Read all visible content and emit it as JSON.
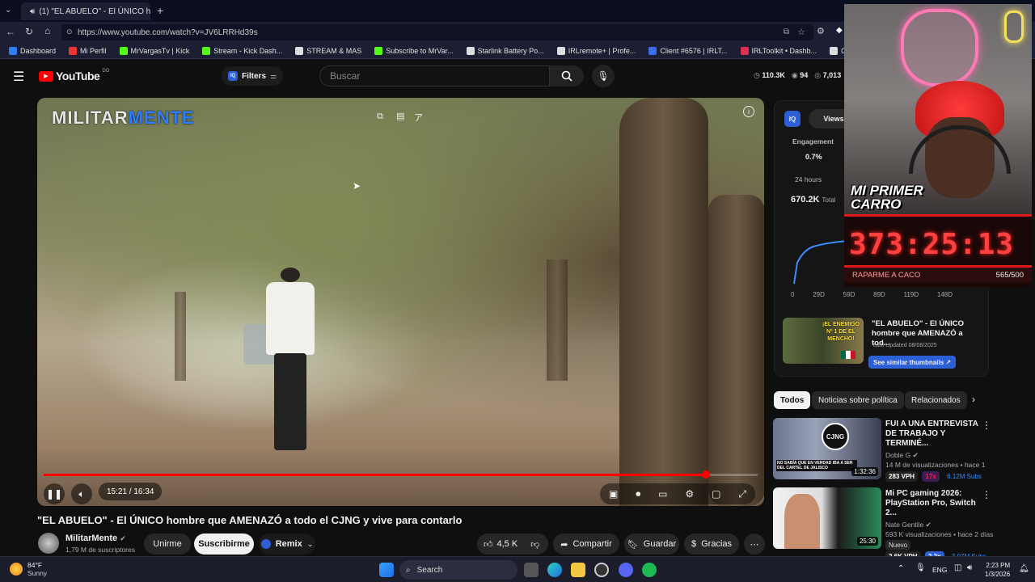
{
  "browser": {
    "tab_title": "(1) \"EL ABUELO\" - El ÚNICO h",
    "url": "https://www.youtube.com/watch?v=JV6LRRHd39s",
    "bookmarks": [
      {
        "label": "Dashboard",
        "color": "#2e7df6"
      },
      {
        "label": "Mi Perfil",
        "color": "#e33"
      },
      {
        "label": "MrVargasTv | Kick",
        "color": "#53fc18"
      },
      {
        "label": "Stream - Kick Dash...",
        "color": "#53fc18"
      },
      {
        "label": "STREAM & MAS",
        "color": "#ddd"
      },
      {
        "label": "Subscribe to MrVar...",
        "color": "#53fc18"
      },
      {
        "label": "Starlink Battery Po...",
        "color": "#ddd"
      },
      {
        "label": "IRLremote+ | Profe...",
        "color": "#ddd"
      },
      {
        "label": "Client #6576 | IRLT...",
        "color": "#3a6ee8"
      },
      {
        "label": "IRLToolkit • Dashb...",
        "color": "#e03050"
      },
      {
        "label": "CONTADOR",
        "color": "#ddd"
      }
    ]
  },
  "youtube": {
    "logo": "YouTube",
    "logo_country": "DO",
    "filters_label": "Filters",
    "search_placeholder": "Buscar",
    "stats": {
      "views": "110.3K",
      "comments": "94",
      "likes": "7,013"
    }
  },
  "player": {
    "watermark_a": "MILITAR",
    "watermark_b": "MENTE",
    "time": "15:21 / 16:34",
    "progress_fraction": 0.927
  },
  "video": {
    "title": "\"EL ABUELO\" - El ÚNICO hombre que AMENAZÓ a todo el CJNG y vive para contarlo",
    "channel": "MilitarMente",
    "subscribers": "1,79 M de suscriptores",
    "join_label": "Unirme",
    "subscribe_label": "Suscribirme",
    "remix_label": "Remix",
    "likes": "4,5 K",
    "share_label": "Compartir",
    "save_label": "Guardar",
    "thanks_label": "Gracias"
  },
  "iq_panel": {
    "views_tab": "Views",
    "engagement_label": "Engagement",
    "engagement_value": "0.7%",
    "period": "24 hours",
    "total_value": "670.2K",
    "total_label": "Total",
    "x_ticks": [
      "0",
      "29D",
      "59D",
      "89D",
      "119D",
      "148D"
    ],
    "card_title": "\"EL ABUELO\" - El ÚNICO hombre que AMENAZÓ a tod...",
    "card_updated": "Last Updated 08/08/2025",
    "similar_label": "See similar thumbnails ↗",
    "thumb_text": "¡EL ENEMIGO Nº 1 DE EL MENCHO!"
  },
  "overlay": {
    "banner": "MI PRIMER CARRO",
    "timer": "373:25:13",
    "goal_label": "RAPARME A CACO",
    "goal_count": "565/500"
  },
  "chips": [
    "Todos",
    "Noticias sobre política",
    "Relacionados"
  ],
  "recommendations": [
    {
      "title": "FUI A UNA ENTREVISTA DE TRABAJO Y TERMINÉ...",
      "channel": "Doble G",
      "meta": "14 M de visualizaciones • hace 1",
      "duration": "1:32:36",
      "vph": "283 VPH",
      "mult": "17x",
      "subs": "6.12M Subs",
      "thumb_caption": "NO SABÍA QUE EN VERDAD IBA A SER DEL CARTEL DE JALISCO",
      "badge": "CJNG"
    },
    {
      "title": "Mi PC gaming 2026: PlayStation Pro, Switch 2...",
      "channel": "Nate Gentile",
      "meta": "593 K visualizaciones • hace 2 días",
      "badge_new": "Nuevo",
      "duration": "25:30",
      "vph": "2.6K VPH",
      "mult": "2.2x",
      "subs": "3.07M Subs"
    }
  ],
  "taskbar": {
    "weather_temp": "84°F",
    "weather_desc": "Sunny",
    "search_label": "Search",
    "lang": "ENG",
    "time": "2:23 PM",
    "date": "1/3/2026"
  }
}
